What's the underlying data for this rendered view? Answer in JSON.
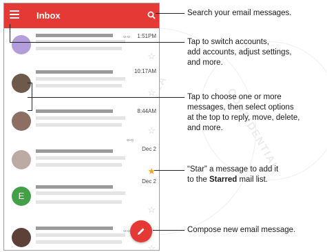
{
  "app": {
    "title": "Inbox",
    "accent_color": "#e53935",
    "icons": {
      "menu": "menu-icon",
      "search": "search-icon",
      "compose": "pencil-icon"
    }
  },
  "emails": [
    {
      "avatar_type": "partial-photo",
      "time": "1:51PM",
      "attachment": true,
      "starred": false
    },
    {
      "avatar_type": "photo",
      "time": "10:17AM",
      "attachment": false,
      "starred": false
    },
    {
      "avatar_type": "photo",
      "time": "8:44AM",
      "attachment": false,
      "starred": false
    },
    {
      "avatar_type": "photo",
      "time": "Dec 2",
      "attachment": true,
      "starred": false
    },
    {
      "avatar_type": "photo",
      "time": "Dec 2",
      "attachment": false,
      "starred": true
    },
    {
      "avatar_type": "letter",
      "avatar_letter": "E",
      "time": "",
      "attachment": false,
      "starred": false
    },
    {
      "avatar_type": "photo",
      "time": "",
      "attachment": true,
      "starred": false
    }
  ],
  "callouts": {
    "search": "Search your email messages.",
    "menu": [
      "Tap to switch accounts,",
      "add accounts, adjust settings,",
      "and more."
    ],
    "select": [
      "Tap to choose one or more",
      "messages, then select options",
      "at the top to reply, move, delete,",
      "and more."
    ],
    "star_prefix": "“Star” a message to add it",
    "star_to": "to the",
    "star_bold": "Starred",
    "star_suffix": "mail list.",
    "compose": "Compose new email message."
  }
}
